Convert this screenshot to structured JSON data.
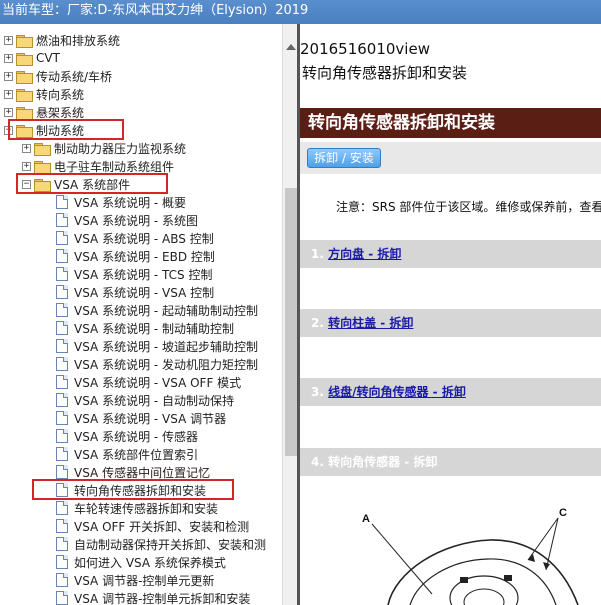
{
  "title_bar": {
    "label": "当前车型：",
    "vehicle": "厂家:D-东风本田艾力绅（Elysion）2019"
  },
  "tree": {
    "items": [
      {
        "label": "燃油和排放系统",
        "type": "folder",
        "expander": "+",
        "level": 0
      },
      {
        "label": "CVT",
        "type": "folder",
        "expander": "+",
        "level": 0
      },
      {
        "label": "传动系统/车桥",
        "type": "folder",
        "expander": "+",
        "level": 0
      },
      {
        "label": "转向系统",
        "type": "folder",
        "expander": "+",
        "level": 0
      },
      {
        "label": "悬架系统",
        "type": "folder",
        "expander": "+",
        "level": 0
      },
      {
        "label": "制动系统",
        "type": "folder",
        "expander": "−",
        "level": 0
      },
      {
        "label": "制动助力器压力监视系统",
        "type": "folder",
        "expander": "+",
        "level": 1
      },
      {
        "label": "电子驻车制动系统组件",
        "type": "folder",
        "expander": "+",
        "level": 1
      },
      {
        "label": "VSA 系统部件",
        "type": "folder",
        "expander": "−",
        "level": 1
      },
      {
        "label": "VSA 系统说明 - 概要",
        "type": "doc",
        "level": 2
      },
      {
        "label": "VSA 系统说明 - 系统图",
        "type": "doc",
        "level": 2
      },
      {
        "label": "VSA 系统说明 - ABS 控制",
        "type": "doc",
        "level": 2
      },
      {
        "label": "VSA 系统说明 - EBD 控制",
        "type": "doc",
        "level": 2
      },
      {
        "label": "VSA 系统说明 - TCS 控制",
        "type": "doc",
        "level": 2
      },
      {
        "label": "VSA 系统说明 - VSA 控制",
        "type": "doc",
        "level": 2
      },
      {
        "label": "VSA 系统说明 - 起动辅助制动控制",
        "type": "doc",
        "level": 2
      },
      {
        "label": "VSA 系统说明 - 制动辅助控制",
        "type": "doc",
        "level": 2
      },
      {
        "label": "VSA 系统说明 - 坡道起步辅助控制",
        "type": "doc",
        "level": 2
      },
      {
        "label": "VSA 系统说明 - 发动机阻力矩控制",
        "type": "doc",
        "level": 2
      },
      {
        "label": "VSA 系统说明 - VSA OFF 模式",
        "type": "doc",
        "level": 2
      },
      {
        "label": "VSA 系统说明 - 自动制动保持",
        "type": "doc",
        "level": 2
      },
      {
        "label": "VSA 系统说明 - VSA 调节器",
        "type": "doc",
        "level": 2
      },
      {
        "label": "VSA 系统说明 - 传感器",
        "type": "doc",
        "level": 2
      },
      {
        "label": "VSA 系统部件位置索引",
        "type": "doc",
        "level": 2
      },
      {
        "label": "VSA 传感器中间位置记忆",
        "type": "doc",
        "level": 2
      },
      {
        "label": "转向角传感器拆卸和安装",
        "type": "doc",
        "level": 2,
        "selected": true
      },
      {
        "label": "车轮转速传感器拆卸和安装",
        "type": "doc",
        "level": 2
      },
      {
        "label": "VSA OFF 开关拆卸、安装和检测",
        "type": "doc",
        "level": 2
      },
      {
        "label": "自动制动器保持开关拆卸、安装和测",
        "type": "doc",
        "level": 2
      },
      {
        "label": "如何进入 VSA 系统保养模式",
        "type": "doc",
        "level": 2
      },
      {
        "label": "VSA 调节器-控制单元更新",
        "type": "doc",
        "level": 2
      },
      {
        "label": "VSA 调节器-控制单元拆卸和安装",
        "type": "doc",
        "level": 2
      }
    ]
  },
  "content": {
    "doc_id": "2016516010view",
    "doc_title": "转向角传感器拆卸和安装",
    "heading": "转向角传感器拆卸和安装",
    "tab_label": "拆卸 / 安装",
    "note": "注意：SRS 部件位于该区域。维修或保养前，查看",
    "steps": [
      {
        "num": "1. ",
        "link": "方向盘 - 拆卸",
        "plain": ""
      },
      {
        "num": "2. ",
        "link": "转向柱盖 - 拆卸",
        "plain": ""
      },
      {
        "num": "3. ",
        "link": "线盘/转向角传感器 - 拆卸",
        "plain": ""
      },
      {
        "num": "4. ",
        "link": "",
        "plain": "转向角传感器 - 拆卸"
      }
    ],
    "figure_labels": {
      "a": "A",
      "c": "C"
    }
  },
  "colors": {
    "title_bar": "#4a7fc0",
    "heading_bar": "#5a1e14",
    "highlight": "#d4252a",
    "link": "#1a1aa8"
  }
}
